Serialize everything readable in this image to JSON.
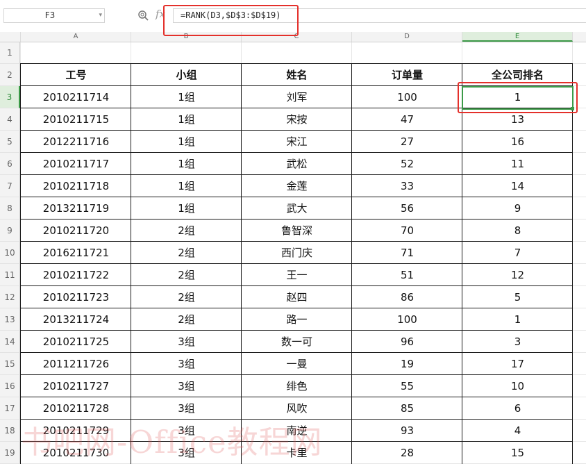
{
  "formula_bar": {
    "name_box": "F3",
    "name_box_arrow": "▾",
    "fx_label": "fx",
    "formula": "=RANK(D3,$D$3:$D$19)"
  },
  "sheet": {
    "columns": [
      "A",
      "B",
      "C",
      "D",
      "E"
    ],
    "selected_column": "E",
    "rows": [
      "1",
      "2",
      "3",
      "4",
      "5",
      "6",
      "7",
      "8",
      "9",
      "10",
      "11",
      "12",
      "13",
      "14",
      "15",
      "16",
      "17",
      "18",
      "19"
    ],
    "selected_row": "3",
    "headers": [
      "工号",
      "小组",
      "姓名",
      "订单量",
      "全公司排名"
    ],
    "data": [
      [
        "2010211714",
        "1组",
        "刘军",
        "100",
        "1"
      ],
      [
        "2010211715",
        "1组",
        "宋按",
        "47",
        "13"
      ],
      [
        "2012211716",
        "1组",
        "宋江",
        "27",
        "16"
      ],
      [
        "2010211717",
        "1组",
        "武松",
        "52",
        "11"
      ],
      [
        "2010211718",
        "1组",
        "金莲",
        "33",
        "14"
      ],
      [
        "2013211719",
        "1组",
        "武大",
        "56",
        "9"
      ],
      [
        "2010211720",
        "2组",
        "鲁智深",
        "70",
        "8"
      ],
      [
        "2016211721",
        "2组",
        "西门庆",
        "71",
        "7"
      ],
      [
        "2010211722",
        "2组",
        "王一",
        "51",
        "12"
      ],
      [
        "2010211723",
        "2组",
        "赵四",
        "86",
        "5"
      ],
      [
        "2013211724",
        "2组",
        "路一",
        "100",
        "1"
      ],
      [
        "2010211725",
        "3组",
        "数一可",
        "96",
        "3"
      ],
      [
        "2011211726",
        "3组",
        "一曼",
        "19",
        "17"
      ],
      [
        "2010211727",
        "3组",
        "绯色",
        "55",
        "10"
      ],
      [
        "2010211728",
        "3组",
        "风吹",
        "85",
        "6"
      ],
      [
        "2010211729",
        "3组",
        "南逆",
        "93",
        "4"
      ],
      [
        "2010211730",
        "3组",
        "卡里",
        "28",
        "15"
      ]
    ]
  },
  "watermark": "书吧网-Office教程网",
  "colors": {
    "highlight_red": "#e4302b",
    "selection_green": "#3c9a48"
  }
}
